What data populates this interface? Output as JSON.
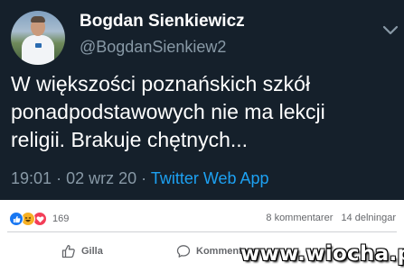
{
  "tweet": {
    "display_name": "Bogdan Sienkiewicz",
    "handle": "@BogdanSienkiew2",
    "text_lines": [
      "W większości poznańskich szkół",
      "ponadpodstawowych nie ma lekcji",
      "religii. Brakuje chętnych..."
    ],
    "time": "19:01",
    "date": "02 wrz 20",
    "separator": "·",
    "source": "Twitter Web App",
    "avatar_icon": "profile-photo",
    "menu_icon": "chevron-down-icon",
    "colors": {
      "background": "#15202b",
      "text": "#ffffff",
      "muted": "#8899a6",
      "link": "#1da1f2"
    }
  },
  "facebook": {
    "reaction_icons": [
      "like-icon",
      "haha-icon",
      "love-icon"
    ],
    "reaction_count": "169",
    "comments": "8 kommentarer",
    "shares": "14 delningar",
    "like_label": "Gilla",
    "comment_label": "Kommentera",
    "colors": {
      "like": "#1877f2",
      "haha": "#f7b125",
      "love": "#f33e58",
      "muted": "#65676b"
    }
  },
  "watermark": {
    "text": "www.wiocha.pl"
  }
}
